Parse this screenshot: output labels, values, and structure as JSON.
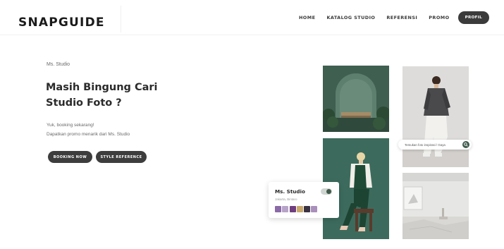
{
  "header": {
    "logo": "SNAPGUIDE",
    "nav": [
      "HOME",
      "KATALOG STUDIO",
      "REFERENSI",
      "PROMO"
    ],
    "profile_button": "PROFIL"
  },
  "hero": {
    "eyebrow": "Ms. Studio",
    "headline_line1": "Masih Bingung Cari",
    "headline_line2": "Studio Foto ?",
    "sub_line1": "Yuk, booking sekarang!",
    "sub_line2": "Dapatkan promo menarik dari Ms. Studio",
    "booking_button": "BOOKING NOW",
    "style_button": "STYLE REFERENCE"
  },
  "search_chip": {
    "text": "Temukan foto inspirasi / Gaya"
  },
  "studio_card": {
    "name": "Ms. Studio",
    "meta": "Jakarta, Bintaro",
    "swatch_colors": [
      "#8b6aa7",
      "#b7a3c7",
      "#6f3e7e",
      "#c9a86c",
      "#3b3342",
      "#a98fbb"
    ]
  },
  "colors": {
    "accent": "#3f5a4b",
    "button_dark": "#3d3d3d",
    "studio_green": "#3e5d4f"
  }
}
